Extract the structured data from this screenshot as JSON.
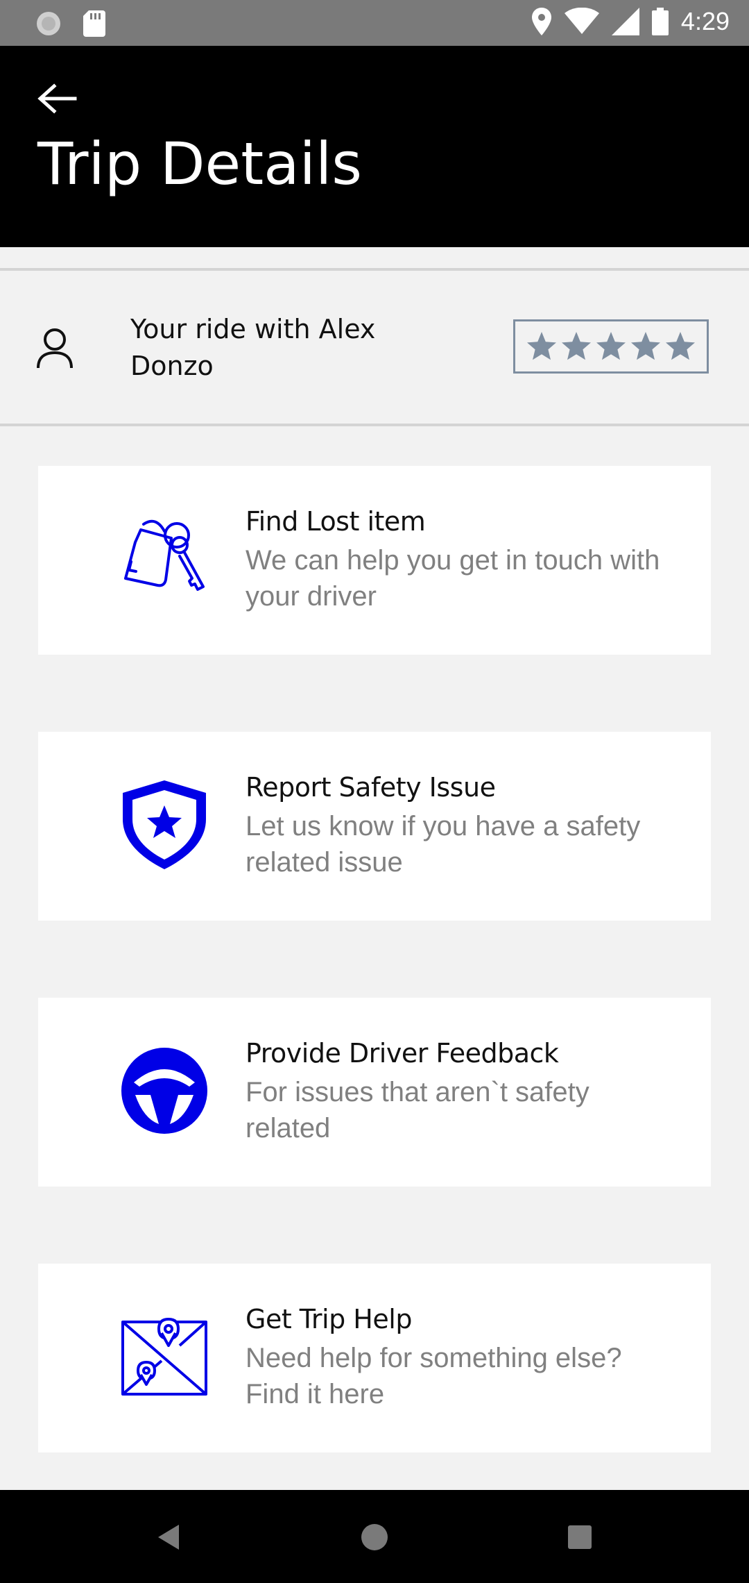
{
  "status_bar": {
    "time": "4:29"
  },
  "header": {
    "title": "Trip Details"
  },
  "ride": {
    "title": "Your ride with Alex Donzo",
    "rating_stars": 5
  },
  "cards": [
    {
      "icon": "keys-tag-icon",
      "title": "Find Lost item",
      "description": "We can help you get in touch with your driver"
    },
    {
      "icon": "shield-star-icon",
      "title": "Report Safety Issue",
      "description": "Let us know if you have a safety related issue"
    },
    {
      "icon": "steering-wheel-icon",
      "title": "Provide Driver Feedback",
      "description": "For issues that aren`t safety related"
    },
    {
      "icon": "map-pin-icon",
      "title": "Get Trip Help",
      "description": "Need help for something else? Find it here"
    }
  ],
  "colors": {
    "accent": "#0000e6",
    "header_bg": "#000000",
    "star": "#7e8ea0",
    "secondary_text": "#808080",
    "status_bar": "#7a7a7a"
  }
}
